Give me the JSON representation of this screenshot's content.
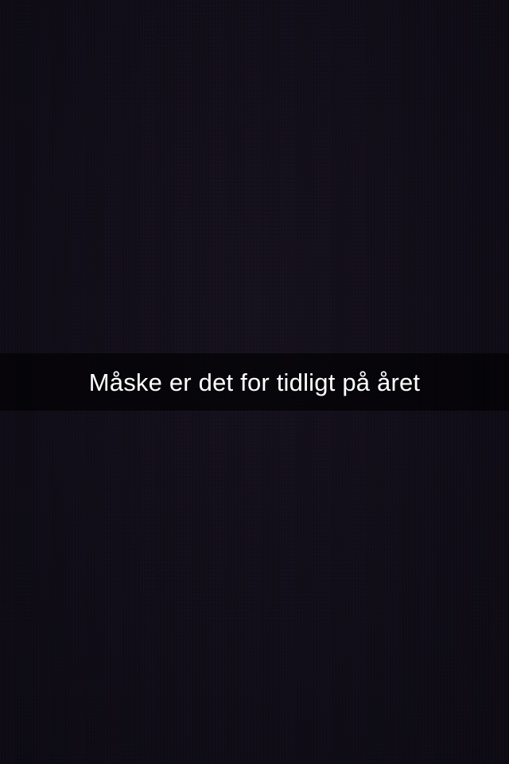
{
  "caption": {
    "text": "Måske er det for tidligt på året"
  },
  "colors": {
    "background": "#100d17",
    "caption_bar": "#000000",
    "caption_text": "#ffffff"
  }
}
